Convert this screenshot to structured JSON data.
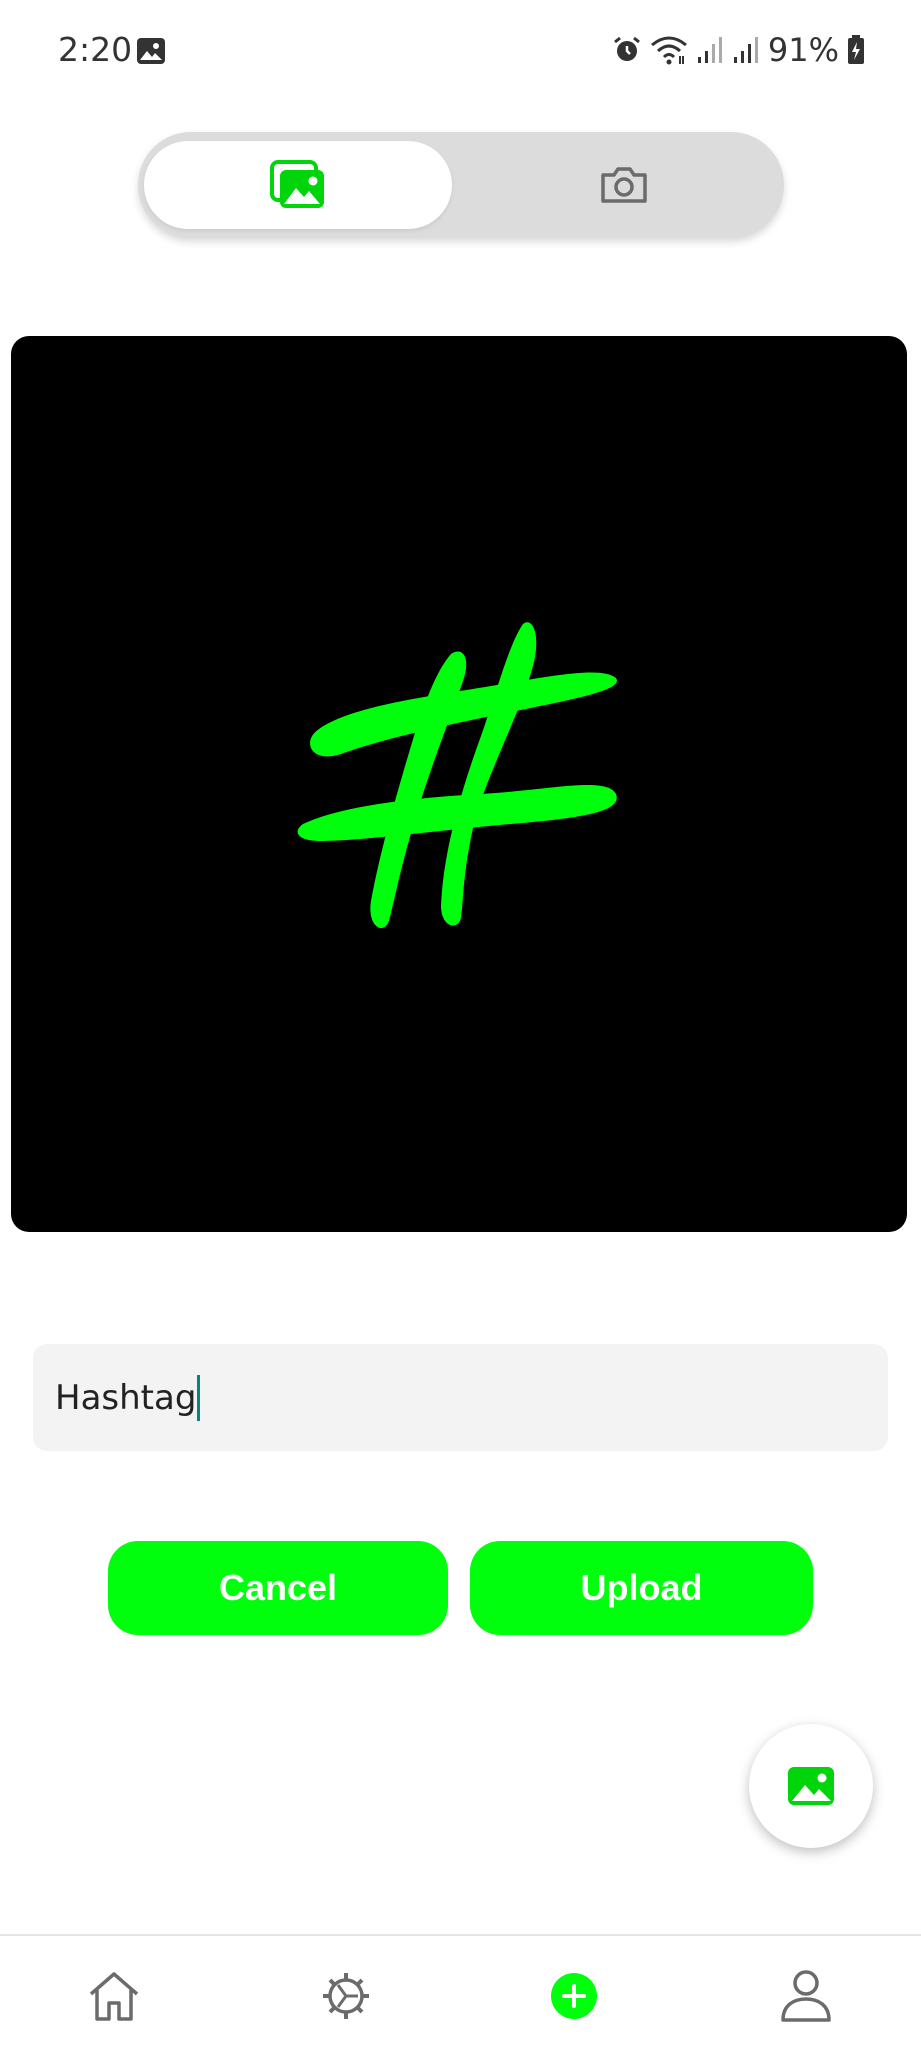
{
  "status_bar": {
    "time": "2:20",
    "battery_percent": "91%",
    "icons": [
      "gallery-notification-icon",
      "alarm-icon",
      "wifi-icon",
      "signal-icon",
      "signal-icon",
      "battery-charging-icon"
    ]
  },
  "source_toggle": {
    "options": [
      {
        "icon": "gallery-icon",
        "selected": true
      },
      {
        "icon": "camera-icon",
        "selected": false
      }
    ]
  },
  "preview": {
    "background": "#000000",
    "symbol_color": "#00ff0d"
  },
  "caption": {
    "value": "Hashtag"
  },
  "actions": {
    "cancel_label": "Cancel",
    "upload_label": "Upload"
  },
  "fab": {
    "icon": "gallery-icon"
  },
  "bottom_nav": {
    "items": [
      {
        "icon": "home-icon"
      },
      {
        "icon": "settings-icon"
      },
      {
        "icon": "add-icon",
        "active": true
      },
      {
        "icon": "profile-icon"
      }
    ]
  },
  "colors": {
    "accent": "#00ff0d",
    "toggle_bg": "#dcdcdc",
    "input_bg": "#f3f3f3",
    "icon_gray": "#6b6b6b"
  }
}
